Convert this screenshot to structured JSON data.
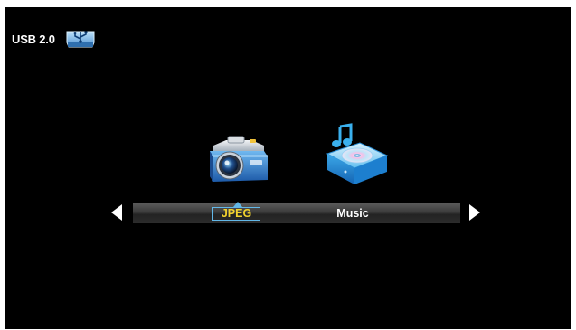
{
  "header": {
    "storage_label": "USB 2.0",
    "storage_icon": "usb-drive-icon"
  },
  "media_menu": {
    "items": [
      {
        "label": "JPEG",
        "icon": "camera-icon",
        "selected": true
      },
      {
        "label": "Music",
        "icon": "music-disc-icon",
        "selected": false
      }
    ],
    "prev_icon": "arrow-left-icon",
    "next_icon": "arrow-right-icon"
  },
  "colors": {
    "background": "#000000",
    "selected_text": "#f2d22e",
    "selected_border": "#62b8e8",
    "text": "#ffffff"
  }
}
